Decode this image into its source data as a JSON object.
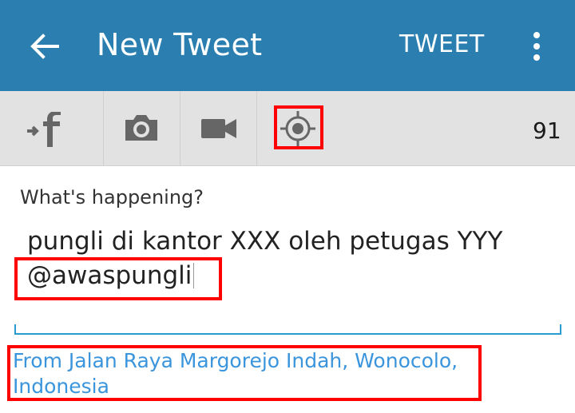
{
  "appbar": {
    "title": "New Tweet",
    "tweet_label": "TWEET",
    "back_icon": "back-arrow-icon",
    "more_icon": "more-vertical-icon",
    "color": "#2b7fb0"
  },
  "toolbar": {
    "items": [
      {
        "name": "facebook-share",
        "icon": "facebook-share-icon"
      },
      {
        "name": "camera",
        "icon": "camera-icon"
      },
      {
        "name": "video",
        "icon": "video-camera-icon"
      },
      {
        "name": "location",
        "icon": "location-target-icon"
      }
    ],
    "char_count": "91"
  },
  "compose": {
    "label": "What's happening?",
    "text_line1": "pungli di kantor XXX oleh petugas YYY",
    "text_line2": "@awaspungli"
  },
  "location": {
    "text": "From Jalan Raya Margorejo Indah, Wonocolo, Indonesia",
    "color": "#3a95dd"
  },
  "highlight_color": "#ff0000"
}
